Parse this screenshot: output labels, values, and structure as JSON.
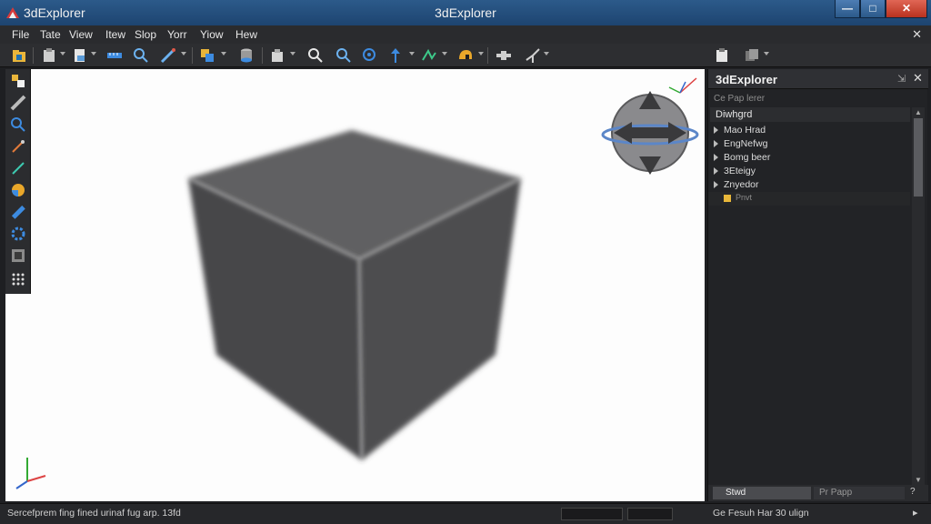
{
  "window": {
    "title_left": "3dExplorer",
    "title_center": "3dExplorer",
    "minimize": "—",
    "maximize": "□",
    "close": "✕"
  },
  "menu": {
    "items": [
      "File",
      "Tate",
      "View",
      "Itew",
      "Slop",
      "Yorr",
      "Yiow",
      "Hew"
    ],
    "close": "✕"
  },
  "toolbar": {
    "icons": [
      "open-icon",
      "paste-icon",
      "document-icon",
      "ruler-icon",
      "search-icon",
      "pen-tool-icon",
      "layers-icon",
      "database-icon",
      "bucket-icon",
      "zoom-icon",
      "zoom-in-icon",
      "zoom-extents-icon",
      "arrow-up-icon",
      "line-tool-icon",
      "helmet-icon",
      "move-icon",
      "axis-icon",
      "clipboard-icon",
      "copy-icon"
    ]
  },
  "left_tools": {
    "icons": [
      "select-icon",
      "ruler-icon",
      "zoom-icon",
      "pipette-icon",
      "line-icon",
      "sphere-icon",
      "pencil-icon",
      "settings-icon",
      "image-icon",
      "grid-icon"
    ]
  },
  "panel": {
    "title": "3dExplorer",
    "pin": "⇲",
    "close": "✕",
    "filter_placeholder": "Ce Pap lerer",
    "root_label": "Diwhgrd",
    "tree_items": [
      "Mao Hrad",
      "EngNefwg",
      "Bomg beer",
      "3Eteigy",
      "Znyedor"
    ],
    "sub_item": "Pnvt",
    "tab_1": "Stwd",
    "tab_2": "Pr Papp",
    "help": "?"
  },
  "status": {
    "left": "Sercefprem fing fined urinaf fug arp. 13fd",
    "right": "Ge Fesuh Har 30 ulign",
    "arrow": "▸"
  },
  "colors": {
    "accent": "#2c5a8a",
    "viewport_bg": "#fdfdfd",
    "cube_front": "#4a4a4c",
    "cube_top": "#5d5d5f",
    "panel_bg": "#222326"
  }
}
